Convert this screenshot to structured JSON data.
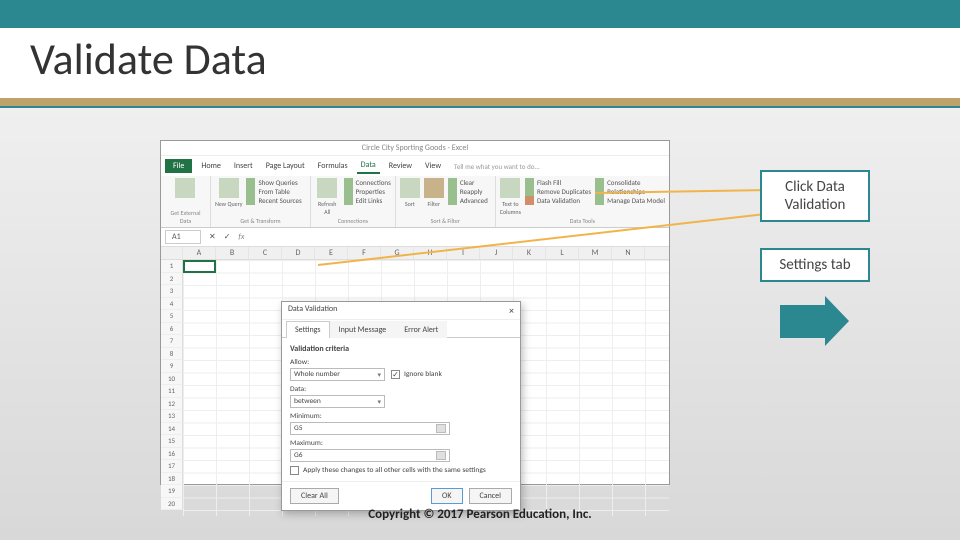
{
  "slide": {
    "title": "Validate Data",
    "copyright": "Copyright © 2017 Pearson Education, Inc."
  },
  "callouts": {
    "c1_line1": "Click Data",
    "c1_line2": "Validation",
    "c2": "Settings tab"
  },
  "excel": {
    "window_title": "Circle City Sporting Goods - Excel",
    "tabs": {
      "file": "File",
      "home": "Home",
      "insert": "Insert",
      "pagelayout": "Page Layout",
      "formulas": "Formulas",
      "data": "Data",
      "review": "Review",
      "view": "View",
      "tellme": "Tell me what you want to do..."
    },
    "namebox": "A1",
    "ribbon": {
      "grp1": {
        "label": "Get External Data",
        "big": "Get External Data"
      },
      "grp2": {
        "label": "Get & Transform",
        "big": "New Query",
        "c1": "Show Queries",
        "c2": "From Table",
        "c3": "Recent Sources"
      },
      "grp3": {
        "label": "Connections",
        "big": "Refresh All",
        "c1": "Connections",
        "c2": "Properties",
        "c3": "Edit Links"
      },
      "grp4": {
        "label": "Sort & Filter",
        "big": "Sort",
        "big2": "Filter",
        "c1": "Clear",
        "c2": "Reapply",
        "c3": "Advanced"
      },
      "grp5": {
        "label": "Data Tools",
        "big": "Text to Columns",
        "c1": "Flash Fill",
        "c2": "Remove Duplicates",
        "c3": "Data Validation",
        "c4": "Consolidate",
        "c5": "Relationships",
        "c6": "Manage Data Model"
      }
    },
    "columns": [
      "A",
      "B",
      "C",
      "D",
      "E",
      "F",
      "G",
      "H",
      "I",
      "J",
      "K",
      "L",
      "M",
      "N"
    ],
    "rows": [
      "1",
      "2",
      "3",
      "4",
      "5",
      "6",
      "7",
      "8",
      "9",
      "10",
      "11",
      "12",
      "13",
      "14",
      "15",
      "16",
      "17",
      "18",
      "19",
      "20"
    ]
  },
  "dialog": {
    "title": "Data Validation",
    "tabs": {
      "settings": "Settings",
      "input": "Input Message",
      "error": "Error Alert"
    },
    "section": "Validation criteria",
    "allow_label": "Allow:",
    "allow_value": "Whole number",
    "ignore_blank": "Ignore blank",
    "data_label": "Data:",
    "data_value": "between",
    "min_label": "Minimum:",
    "min_value": "G5",
    "max_label": "Maximum:",
    "max_value": "G6",
    "apply_text": "Apply these changes to all other cells with the same settings",
    "clear": "Clear All",
    "ok": "OK",
    "cancel": "Cancel"
  }
}
